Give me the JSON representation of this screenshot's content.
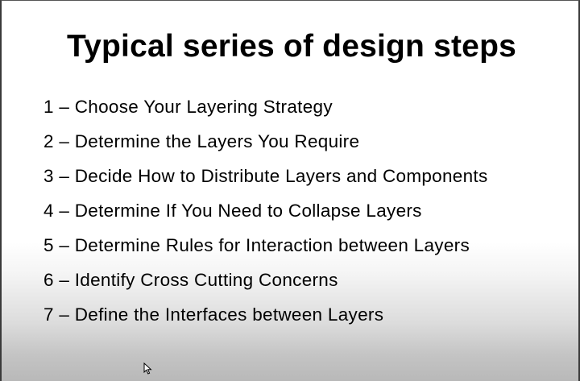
{
  "slide": {
    "title": "Typical series of design steps",
    "steps": [
      "1 – Choose Your Layering Strategy",
      "2 – Determine the Layers You Require",
      "3 – Decide How to Distribute Layers and Components",
      "4 – Determine If You Need to Collapse Layers",
      "5 – Determine Rules for Interaction between Layers",
      "6 – Identify Cross Cutting Concerns",
      "7 – Define the Interfaces between Layers"
    ]
  },
  "icons": {
    "cursor": "mouse-pointer-icon"
  }
}
